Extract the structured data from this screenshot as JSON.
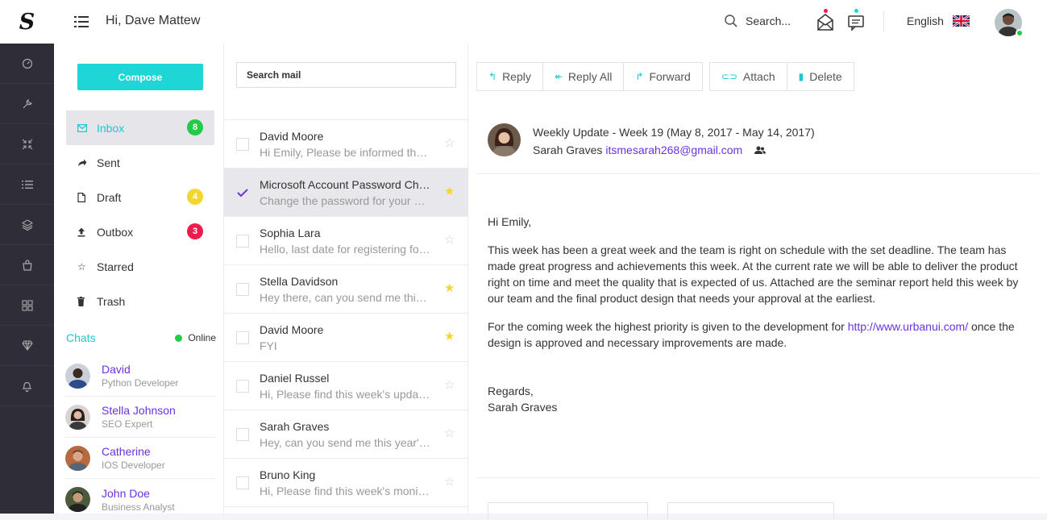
{
  "brand": {
    "logo_letter": "S"
  },
  "header": {
    "greeting": "Hi, Dave Mattew",
    "search_label": "Search...",
    "language": "English"
  },
  "rail": {
    "icons": [
      "dashboard-icon",
      "wrench-icon",
      "collapse-icon",
      "list-icon",
      "layers-icon",
      "bag-icon",
      "grid-icon",
      "diamond-icon",
      "bell-icon"
    ]
  },
  "folders": {
    "compose_label": "Compose",
    "items": [
      {
        "label": "Inbox",
        "icon": "envelope-icon",
        "badge": "8",
        "badge_color": "#22cc44"
      },
      {
        "label": "Sent",
        "icon": "send-icon",
        "badge": "",
        "badge_color": ""
      },
      {
        "label": "Draft",
        "icon": "file-icon",
        "badge": "4",
        "badge_color": "#f5d630"
      },
      {
        "label": "Outbox",
        "icon": "upload-icon",
        "badge": "3",
        "badge_color": "#ee1c4a"
      },
      {
        "label": "Starred",
        "icon": "star-icon",
        "badge": "",
        "badge_color": ""
      },
      {
        "label": "Trash",
        "icon": "trash-icon",
        "badge": "",
        "badge_color": ""
      }
    ]
  },
  "chats": {
    "title": "Chats",
    "status": "Online",
    "people": [
      {
        "name": "David",
        "role": "Python Developer"
      },
      {
        "name": "Stella Johnson",
        "role": "SEO Expert"
      },
      {
        "name": "Catherine",
        "role": "IOS Developer"
      },
      {
        "name": "John Doe",
        "role": "Business Analyst"
      }
    ]
  },
  "message_list": {
    "search_placeholder": "Search mail",
    "items": [
      {
        "from": "David Moore",
        "preview": "Hi Emily, Please be informed that the new project presentation",
        "starred": false,
        "checked": false
      },
      {
        "from": "Microsoft Account Password Change",
        "preview": "Change the password for your Microsoft account",
        "starred": true,
        "checked": true
      },
      {
        "from": "Sophia Lara",
        "preview": "Hello, last date for registering for the annual event",
        "starred": false,
        "checked": false
      },
      {
        "from": "Stella Davidson",
        "preview": "Hey there, can you send me this week's report",
        "starred": true,
        "checked": false
      },
      {
        "from": "David Moore",
        "preview": "FYI",
        "starred": true,
        "checked": false
      },
      {
        "from": "Daniel Russel",
        "preview": "Hi, Please find this week's update report",
        "starred": false,
        "checked": false
      },
      {
        "from": "Sarah Graves",
        "preview": "Hey, can you send me this year's report",
        "starred": false,
        "checked": false
      },
      {
        "from": "Bruno King",
        "preview": "Hi, Please find this week's monitoring report",
        "starred": false,
        "checked": false
      }
    ]
  },
  "reader": {
    "toolbar": {
      "reply": "Reply",
      "reply_all": "Reply All",
      "forward": "Forward",
      "attach": "Attach",
      "delete": "Delete"
    },
    "subject": "Weekly Update - Week 19 (May 8, 2017 - May 14, 2017)",
    "sender_name": "Sarah Graves",
    "sender_email": "itsmesarah268@gmail.com",
    "greeting": "Hi Emily,",
    "paragraph1": "This week has been a great week and the team is right on schedule with the set deadline. The team has made great progress and achievements this week. At the current rate we will be able to deliver the product right on time and meet the quality that is expected of us. Attached are the seminar report held this week by our team and the final product design that needs your approval at the earliest.",
    "paragraph2_before": "For the coming week the highest priority is given to the development for ",
    "paragraph2_link": "http://www.urbanui.com/",
    "paragraph2_after": " once the design is approved and necessary improvements are made.",
    "regards": "Regards,",
    "signature": "Sarah Graves"
  },
  "colors": {
    "accent": "#1fd6d6",
    "link": "#6a33e0",
    "rail": "#2f2d38",
    "star_active": "#f5d630"
  }
}
